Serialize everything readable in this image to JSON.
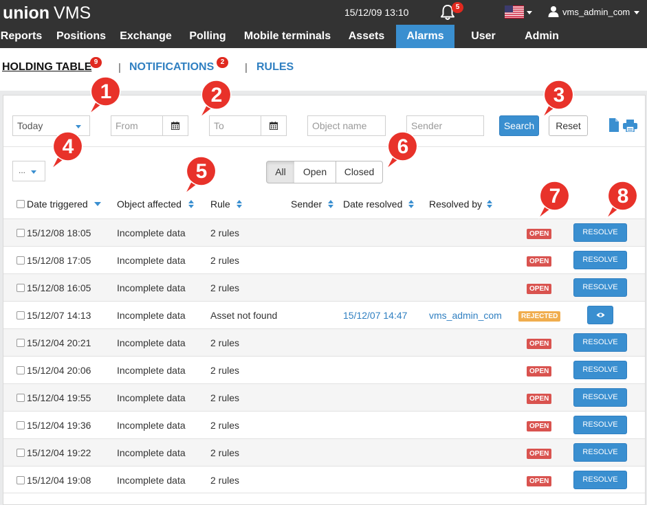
{
  "header": {
    "logo_bold": "union",
    "logo_light": "VMS",
    "datetime": "15/12/09 13:10",
    "bell_count": "5",
    "user_name": "vms_admin_com"
  },
  "nav": {
    "items": [
      "Reports",
      "Positions",
      "Exchange",
      "Polling",
      "Mobile terminals",
      "Assets",
      "Alarms",
      "User",
      "Admin"
    ],
    "active": "Alarms"
  },
  "subnav": {
    "holding": "HOLDING TABLE",
    "holding_count": "9",
    "sep": "|",
    "notifications": "NOTIFICATIONS",
    "notifications_count": "2",
    "rules": "RULES"
  },
  "filters": {
    "period": "Today",
    "from_placeholder": "From",
    "to_placeholder": "To",
    "object_placeholder": "Object name",
    "sender_placeholder": "Sender",
    "search": "Search",
    "reset": "Reset",
    "bulk": "...",
    "tabs": [
      "All",
      "Open",
      "Closed"
    ],
    "active_tab": "All"
  },
  "table": {
    "headers": {
      "date_triggered": "Date triggered",
      "object_affected": "Object affected",
      "rule": "Rule",
      "sender": "Sender",
      "date_resolved": "Date resolved",
      "resolved_by": "Resolved by"
    },
    "resolve_label": "RESOLVE",
    "rows": [
      {
        "date": "15/12/08 18:05",
        "object": "Incomplete data",
        "rule": "2 rules",
        "sender": "",
        "resolved": "",
        "by": "",
        "status": "OPEN"
      },
      {
        "date": "15/12/08 17:05",
        "object": "Incomplete data",
        "rule": "2 rules",
        "sender": "",
        "resolved": "",
        "by": "",
        "status": "OPEN"
      },
      {
        "date": "15/12/08 16:05",
        "object": "Incomplete data",
        "rule": "2 rules",
        "sender": "",
        "resolved": "",
        "by": "",
        "status": "OPEN"
      },
      {
        "date": "15/12/07 14:13",
        "object": "Incomplete data",
        "rule": "Asset not found",
        "sender": "",
        "resolved": "15/12/07 14:47",
        "by": "vms_admin_com",
        "status": "REJECTED"
      },
      {
        "date": "15/12/04 20:21",
        "object": "Incomplete data",
        "rule": "2 rules",
        "sender": "",
        "resolved": "",
        "by": "",
        "status": "OPEN"
      },
      {
        "date": "15/12/04 20:06",
        "object": "Incomplete data",
        "rule": "2 rules",
        "sender": "",
        "resolved": "",
        "by": "",
        "status": "OPEN"
      },
      {
        "date": "15/12/04 19:55",
        "object": "Incomplete data",
        "rule": "2 rules",
        "sender": "",
        "resolved": "",
        "by": "",
        "status": "OPEN"
      },
      {
        "date": "15/12/04 19:36",
        "object": "Incomplete data",
        "rule": "2 rules",
        "sender": "",
        "resolved": "",
        "by": "",
        "status": "OPEN"
      },
      {
        "date": "15/12/04 19:22",
        "object": "Incomplete data",
        "rule": "2 rules",
        "sender": "",
        "resolved": "",
        "by": "",
        "status": "OPEN"
      },
      {
        "date": "15/12/04 19:08",
        "object": "Incomplete data",
        "rule": "2 rules",
        "sender": "",
        "resolved": "",
        "by": "",
        "status": "OPEN"
      }
    ]
  },
  "callouts": [
    "1",
    "2",
    "3",
    "4",
    "5",
    "6",
    "7",
    "8"
  ],
  "colors": {
    "topbar": "#333333",
    "accent": "#3a8fd0",
    "open_status": "#d9534f",
    "rejected_status": "#f0ad4e",
    "callout": "#e8322a",
    "badge": "#e0291f"
  }
}
